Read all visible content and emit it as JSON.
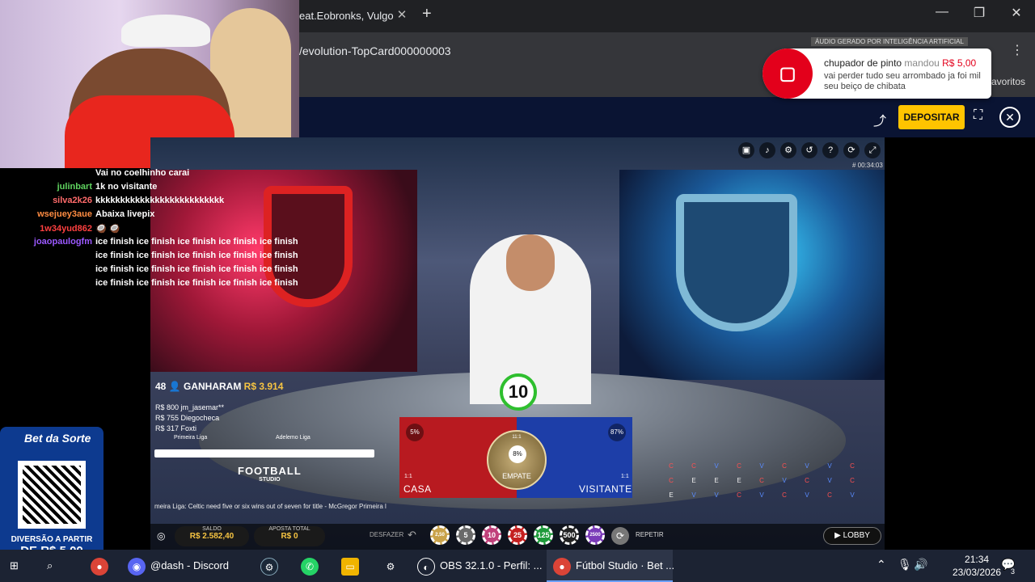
{
  "browser": {
    "tab_title": "eat.Eobronks, Vulgo",
    "tab_close": "✕",
    "new_tab": "+",
    "url": "/evolution-TopCard000000003",
    "menu": "⋮",
    "bookmarks_label": "avoritos",
    "window": {
      "minimize": "—",
      "restore": "❐",
      "close": "✕"
    }
  },
  "site": {
    "share_icon": "share-icon",
    "deposit_label": "DEPOSITAR",
    "expand": "⛶",
    "close": "✕"
  },
  "alert": {
    "ai_note": "ÁUDIO GERADO POR INTELIGÊNCIA ARTIFICIAL",
    "badge": "▢",
    "user": "chupador de pinto",
    "action": "mandou",
    "amount": "R$ 5,00",
    "message": "vai perder tudo seu arrombado ja foi mil seu beiço de chibata"
  },
  "chat": [
    {
      "user": "",
      "text": "Vai no coelhinho carai",
      "color": "#8fa3ff"
    },
    {
      "user": "julinbart",
      "text": "1k no visitante",
      "color": "#5fd35f"
    },
    {
      "user": "silva2k26",
      "text": "kkkkkkkkkkkkkkkkkkkkkkkkkk",
      "color": "#ff6b6b"
    },
    {
      "user": "wsejuey3aue",
      "text": "Abaixa livepix",
      "color": "#ff8c42"
    },
    {
      "user": "1w34yud862",
      "text": "🥥 🥥",
      "color": "#ff4040"
    },
    {
      "user": "joaopaulogfm",
      "text": "ice finish ice finish ice finish ice finish ice finish",
      "color": "#9b59ff"
    },
    {
      "user": "",
      "text": "ice finish ice finish ice finish ice finish ice finish",
      "color": "#fff"
    },
    {
      "user": "",
      "text": "ice finish ice finish ice finish ice finish ice finish",
      "color": "#fff"
    },
    {
      "user": "",
      "text": "ice finish ice finish ice finish ice finish ice finish",
      "color": "#fff"
    }
  ],
  "game": {
    "video_time": "# 00:34:03",
    "timer": "10",
    "winners_count": "48",
    "winners_label": "GANHARAM",
    "winners_amount": "R$ 3.914",
    "winners_list": [
      {
        "amount": "R$ 800",
        "name": "jm_jasemar**"
      },
      {
        "amount": "R$ 755",
        "name": "Diegocheca"
      },
      {
        "amount": "R$ 317",
        "name": "Foxti"
      }
    ],
    "league_left": "Primeira Liga",
    "league_right": "Adelemo Liga",
    "logo_title": "FOOTBALL",
    "logo_sub": "STUDIO",
    "ticker": "meira Liga:  Celtic need five or six wins out of seven for title - McGregor     Primeira l",
    "casa_label": "CASA",
    "casa_pct": "5%",
    "casa_odds": "1:1",
    "visitante_label": "VISITANTE",
    "visitante_pct": "87%",
    "visitante_odds": "1:1",
    "empate_label": "EMPATE",
    "empate_pct": "8%",
    "empate_odds": "11:1",
    "road": [
      [
        "C",
        "C",
        "V",
        "C",
        "V",
        "C",
        "V",
        "V",
        "C"
      ],
      [
        "C",
        "E",
        "E",
        "E",
        "C",
        "V",
        "C",
        "V",
        "C"
      ],
      [
        "E",
        "V",
        "V",
        "C",
        "V",
        "C",
        "V",
        "C",
        "V"
      ]
    ],
    "saldo_label": "SALDO",
    "saldo_value": "R$ 2.582,40",
    "aposta_label": "APOSTA TOTAL",
    "aposta_value": "R$ 0",
    "desfazer": "DESFAZER",
    "chips": [
      {
        "label": "2,50",
        "color": "#c9a24a"
      },
      {
        "label": "5",
        "color": "#6a6a6a"
      },
      {
        "label": "10",
        "color": "#c0407a"
      },
      {
        "label": "25",
        "color": "#c42020"
      },
      {
        "label": "125",
        "color": "#1e9a3a"
      },
      {
        "label": "500",
        "color": "#222"
      },
      {
        "label": "2500",
        "color": "#7a3ab8"
      }
    ],
    "repetir": "REPETIR",
    "lobby": "LOBBY"
  },
  "qr": {
    "brand": "Bet da Sorte",
    "line1": "DIVERSÃO A PARTIR",
    "line2": "DE R$ 5,00"
  },
  "taskbar": {
    "discord": "@dash - Discord",
    "obs": "OBS 32.1.0 - Perfil: ...",
    "chrome": "Fútbol Studio · Bet ...",
    "time": "21:34",
    "date": "23/03/2026",
    "notif_count": "3"
  }
}
